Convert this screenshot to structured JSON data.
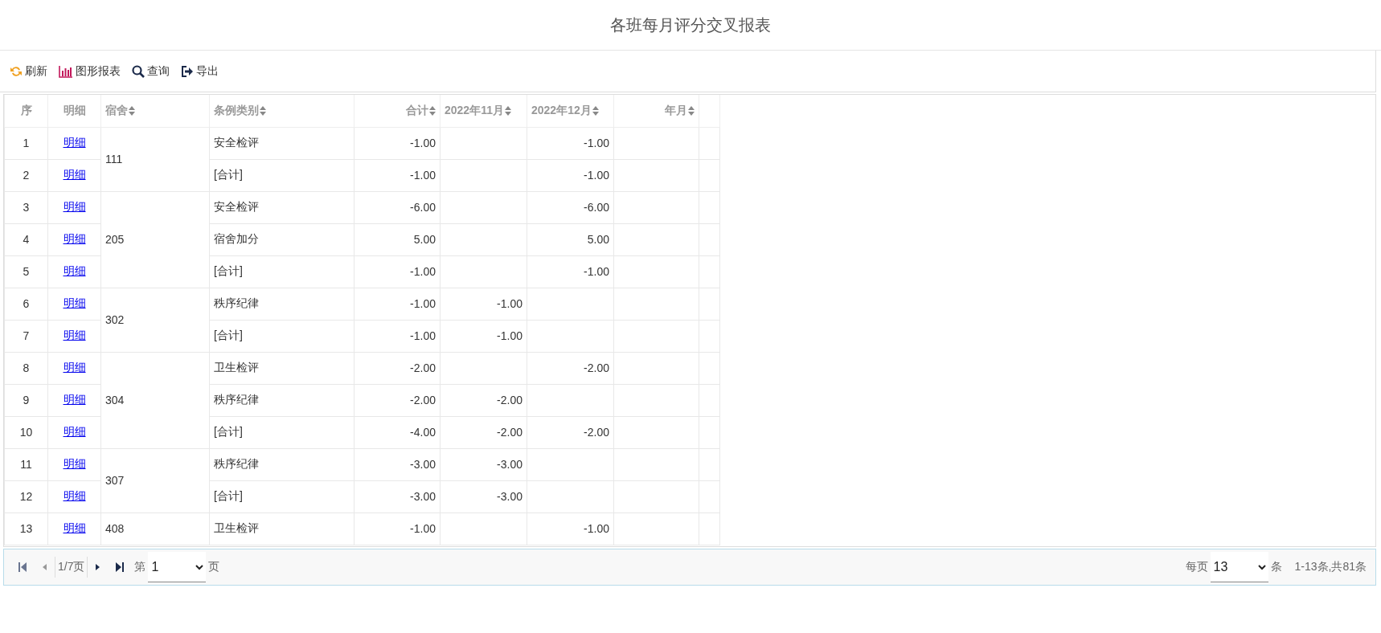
{
  "title": "各班每月评分交叉报表",
  "toolbar": [
    {
      "kind": "refresh",
      "label": "刷新"
    },
    {
      "kind": "chart",
      "label": "图形报表"
    },
    {
      "kind": "search",
      "label": "查询"
    },
    {
      "kind": "export",
      "label": "导出"
    }
  ],
  "table": {
    "columns": [
      {
        "label": "序",
        "sortable": false
      },
      {
        "label": "明细",
        "sortable": false
      },
      {
        "label": "宿舍",
        "sortable": true
      },
      {
        "label": "条例类别",
        "sortable": true
      },
      {
        "label": "合计",
        "sortable": true
      },
      {
        "label": "2022年11月",
        "sortable": true
      },
      {
        "label": "2022年12月",
        "sortable": true
      },
      {
        "label": "年月",
        "sortable": true
      }
    ],
    "groups": [
      {
        "dorm": "111",
        "rows": [
          {
            "index": "1",
            "link": "明细",
            "category": "安全检评",
            "total": "-1.00",
            "nov": "",
            "dec": "-1.00"
          },
          {
            "index": "2",
            "link": "明细",
            "category": "[合计]",
            "total": "-1.00",
            "nov": "",
            "dec": "-1.00"
          }
        ]
      },
      {
        "dorm": "205",
        "rows": [
          {
            "index": "3",
            "link": "明细",
            "category": "安全检评",
            "total": "-6.00",
            "nov": "",
            "dec": "-6.00"
          },
          {
            "index": "4",
            "link": "明细",
            "category": "宿舍加分",
            "total": "5.00",
            "nov": "",
            "dec": "5.00"
          },
          {
            "index": "5",
            "link": "明细",
            "category": "[合计]",
            "total": "-1.00",
            "nov": "",
            "dec": "-1.00"
          }
        ]
      },
      {
        "dorm": "302",
        "rows": [
          {
            "index": "6",
            "link": "明细",
            "category": "秩序纪律",
            "total": "-1.00",
            "nov": "-1.00",
            "dec": ""
          },
          {
            "index": "7",
            "link": "明细",
            "category": "[合计]",
            "total": "-1.00",
            "nov": "-1.00",
            "dec": ""
          }
        ]
      },
      {
        "dorm": "304",
        "rows": [
          {
            "index": "8",
            "link": "明细",
            "category": "卫生检评",
            "total": "-2.00",
            "nov": "",
            "dec": "-2.00"
          },
          {
            "index": "9",
            "link": "明细",
            "category": "秩序纪律",
            "total": "-2.00",
            "nov": "-2.00",
            "dec": ""
          },
          {
            "index": "10",
            "link": "明细",
            "category": "[合计]",
            "total": "-4.00",
            "nov": "-2.00",
            "dec": "-2.00"
          }
        ]
      },
      {
        "dorm": "307",
        "rows": [
          {
            "index": "11",
            "link": "明细",
            "category": "秩序纪律",
            "total": "-3.00",
            "nov": "-3.00",
            "dec": ""
          },
          {
            "index": "12",
            "link": "明细",
            "category": "[合计]",
            "total": "-3.00",
            "nov": "-3.00",
            "dec": ""
          }
        ]
      },
      {
        "dorm": "408",
        "rows": [
          {
            "index": "13",
            "link": "明细",
            "category": "卫生检评",
            "total": "-1.00",
            "nov": "",
            "dec": "-1.00"
          }
        ]
      }
    ]
  },
  "pager": {
    "page_info": "1/7页",
    "page_prefix": "第",
    "page_value": "1",
    "page_suffix": "页",
    "size_prefix": "每页",
    "size_value": "13",
    "size_suffix": "条",
    "summary": "1-13条,共81条"
  }
}
